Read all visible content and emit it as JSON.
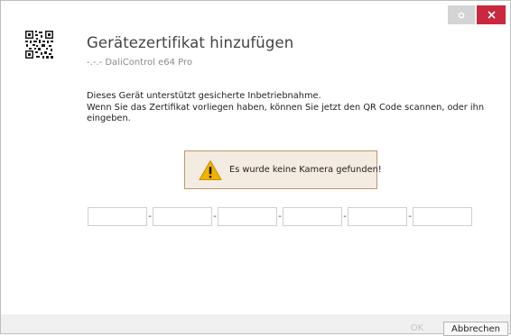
{
  "window": {
    "controls": [
      {
        "icon": "gear-icon",
        "color": "#d4d4d4"
      },
      {
        "icon": "close-icon",
        "color": "#c9283e"
      }
    ]
  },
  "header": {
    "icon": "qr-code-icon",
    "title": "Gerätezertifikat hinzufügen",
    "subtitle": "-.-.- DaliControl e64 Pro"
  },
  "description": {
    "line1": "Dieses Gerät unterstützt gesicherte Inbetriebnahme.",
    "line2": "Wenn Sie das Zertifikat vorliegen haben, können Sie jetzt den QR Code scannen, oder ihn",
    "line3": "eingeben."
  },
  "warning": {
    "icon": "warning-icon",
    "text": "Es wurde keine Kamera gefunden!",
    "background": "#f4ece0",
    "border": "#b99a6c"
  },
  "code_fields": {
    "values": [
      "",
      "",
      "",
      "",
      "",
      ""
    ],
    "separator": "-"
  },
  "footer": {
    "ok_label": "OK",
    "cancel_label": "Abbrechen"
  }
}
